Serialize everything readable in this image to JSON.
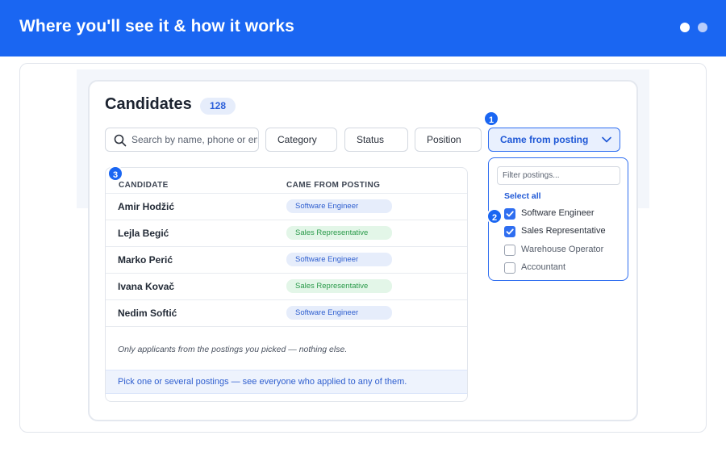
{
  "header": {
    "title": "Where you'll see it & how it works"
  },
  "page": {
    "title": "Candidates",
    "count": "128"
  },
  "search": {
    "placeholder": "Search by name, phone or email..."
  },
  "filters": {
    "category": "Category",
    "status": "Status",
    "position": "Position",
    "came_from_posting": "Came from posting"
  },
  "table": {
    "headers": {
      "candidate": "CANDIDATE",
      "came_from_posting": "CAME FROM POSTING"
    },
    "rows": [
      {
        "name": "Amir Hodžić",
        "posting": "Software Engineer"
      },
      {
        "name": "Lejla Begić",
        "posting": "Sales Representative"
      },
      {
        "name": "Marko Perić",
        "posting": "Software Engineer"
      },
      {
        "name": "Ivana Kovač",
        "posting": "Sales Representative"
      },
      {
        "name": "Nedim Softić",
        "posting": "Software Engineer"
      }
    ],
    "note": "Only applicants from the postings you picked — nothing else.",
    "footer": "Pick one or several postings — see everyone who applied to any of them."
  },
  "dropdown": {
    "filter_placeholder": "Filter postings...",
    "select_all": "Select all",
    "options": [
      {
        "label": "Software Engineer",
        "checked": true
      },
      {
        "label": "Sales Representative",
        "checked": true
      },
      {
        "label": "Warehouse Operator",
        "checked": false
      },
      {
        "label": "Accountant",
        "checked": false
      }
    ]
  },
  "markers": [
    "1",
    "2",
    "3"
  ],
  "colors": {
    "brand": "#1a66f2",
    "accent": "#2f6ef0",
    "pill_blue": "#e6edfb",
    "pill_green": "#e3f6e8"
  }
}
